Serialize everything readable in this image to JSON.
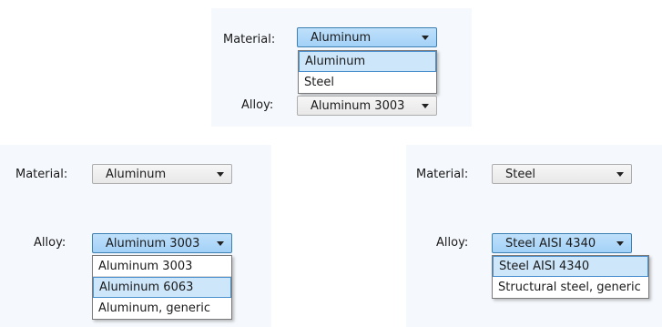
{
  "panels": [
    {
      "material_label": "Material:",
      "material_value": "Aluminum",
      "alloy_label": "Alloy:",
      "alloy_value": "Aluminum 3003",
      "dropdown_options": [
        "Aluminum",
        "Steel"
      ],
      "selected_option": "Aluminum"
    },
    {
      "material_label": "Material:",
      "material_value": "Aluminum",
      "alloy_label": "Alloy:",
      "alloy_value": "Aluminum 3003",
      "dropdown_options": [
        "Aluminum 3003",
        "Aluminum 6063",
        "Aluminum, generic"
      ],
      "selected_option": "Aluminum 6063"
    },
    {
      "material_label": "Material:",
      "material_value": "Steel",
      "alloy_label": "Alloy:",
      "alloy_value": "Steel AISI 4340",
      "dropdown_options": [
        "Steel AISI 4340",
        "Structural steel, generic"
      ],
      "selected_option": "Steel AISI 4340"
    }
  ],
  "colors": {
    "panel_bg": "#f5f8fc",
    "active_combo": "#a3d1f7",
    "selected_option_bg": "#cde6fa",
    "selected_option_border": "#4a90cf"
  },
  "icons": [
    "chevron-down-icon"
  ]
}
